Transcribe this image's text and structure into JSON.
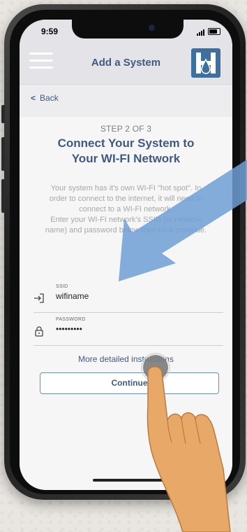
{
  "status_bar": {
    "time": "9:59"
  },
  "header": {
    "title": "Add a System",
    "menu_icon": "hamburger-menu-icon",
    "logo_icon": "h-logo-icon"
  },
  "nav": {
    "back_label": "Back",
    "back_icon": "chevron-left-icon"
  },
  "main": {
    "step": "STEP 2 OF 3",
    "heading_line1": "Connect Your System to",
    "heading_line2": "Your WI-FI Network",
    "paragraph_lines": [
      "Your system has it's own WI-FI \"hot spot\". In",
      "order to connect to the internet, it will need to",
      "connect to a WI-FI network.",
      "Enter your WI-FI network's SSID (or network",
      "name) and password below then click continue."
    ]
  },
  "form": {
    "ssid": {
      "label": "SSID",
      "value": "wifiname",
      "icon": "login-arrow-icon"
    },
    "password": {
      "label": "PASSWORD",
      "value": "•••••••••",
      "icon": "lock-icon"
    }
  },
  "links": {
    "more_instructions": "More detailed instructions"
  },
  "actions": {
    "continue_label": "Continue"
  },
  "colors": {
    "accent": "#3f5a82",
    "arrow": "#6f9fd6",
    "hand": "#e8a968",
    "tap_circle": "#7b7b7b"
  }
}
